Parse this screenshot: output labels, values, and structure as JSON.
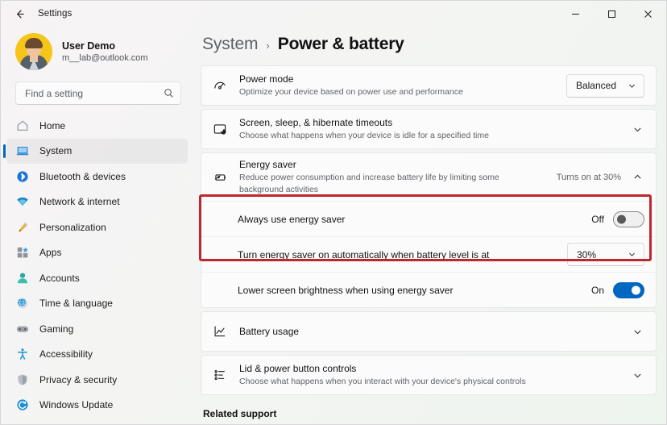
{
  "window": {
    "title": "Settings",
    "back_icon": "arrow-left-icon",
    "controls": [
      {
        "name": "minimize",
        "glyph": "–"
      },
      {
        "name": "maximize",
        "glyph": "□"
      },
      {
        "name": "close",
        "glyph": "✕"
      }
    ]
  },
  "account": {
    "name": "User Demo",
    "email": "m__lab@outlook.com"
  },
  "search": {
    "placeholder": "Find a setting",
    "value": "",
    "icon": "search-icon"
  },
  "sidebar": {
    "items": [
      {
        "label": "Home",
        "icon": "home-icon",
        "selected": false
      },
      {
        "label": "System",
        "icon": "system-icon",
        "selected": true
      },
      {
        "label": "Bluetooth & devices",
        "icon": "bluetooth-icon",
        "selected": false
      },
      {
        "label": "Network & internet",
        "icon": "network-icon",
        "selected": false
      },
      {
        "label": "Personalization",
        "icon": "personalization-icon",
        "selected": false
      },
      {
        "label": "Apps",
        "icon": "apps-icon",
        "selected": false
      },
      {
        "label": "Accounts",
        "icon": "accounts-icon",
        "selected": false
      },
      {
        "label": "Time & language",
        "icon": "time-language-icon",
        "selected": false
      },
      {
        "label": "Gaming",
        "icon": "gaming-icon",
        "selected": false
      },
      {
        "label": "Accessibility",
        "icon": "accessibility-icon",
        "selected": false
      },
      {
        "label": "Privacy & security",
        "icon": "privacy-security-icon",
        "selected": false
      },
      {
        "label": "Windows Update",
        "icon": "windows-update-icon",
        "selected": false
      }
    ]
  },
  "breadcrumb": {
    "parent": "System",
    "separator": "›",
    "current": "Power & battery"
  },
  "settings": {
    "power_mode": {
      "title": "Power mode",
      "subtitle": "Optimize your device based on power use and performance",
      "icon": "gauge-icon",
      "dropdown_value": "Balanced"
    },
    "screen_sleep": {
      "title": "Screen, sleep, & hibernate timeouts",
      "subtitle": "Choose what happens when your device is idle for a specified time",
      "icon": "screen-moon-icon",
      "chevron": "chevron-down-icon"
    },
    "energy_saver": {
      "title": "Energy saver",
      "subtitle": "Reduce power consumption and increase battery life by limiting some background activities",
      "icon": "battery-leaf-icon",
      "status": "Turns on at 30%",
      "chevron": "chevron-up-icon",
      "always_use": {
        "label": "Always use energy saver",
        "toggle_state": "Off"
      },
      "auto_threshold": {
        "label": "Turn energy saver on automatically when battery level is at",
        "dropdown_value": "30%"
      },
      "lower_brightness": {
        "label": "Lower screen brightness when using energy saver",
        "toggle_state": "On"
      }
    },
    "battery_usage": {
      "title": "Battery usage",
      "icon": "chart-line-icon",
      "chevron": "chevron-down-icon"
    },
    "lid_power": {
      "title": "Lid & power button controls",
      "subtitle": "Choose what happens when you interact with your device's physical controls",
      "icon": "list-icon",
      "chevron": "chevron-down-icon"
    }
  },
  "related_support": {
    "heading": "Related support"
  },
  "colors": {
    "accent": "#0067c0",
    "highlight_box": "#c0272d",
    "card": "#fbfbfb"
  }
}
